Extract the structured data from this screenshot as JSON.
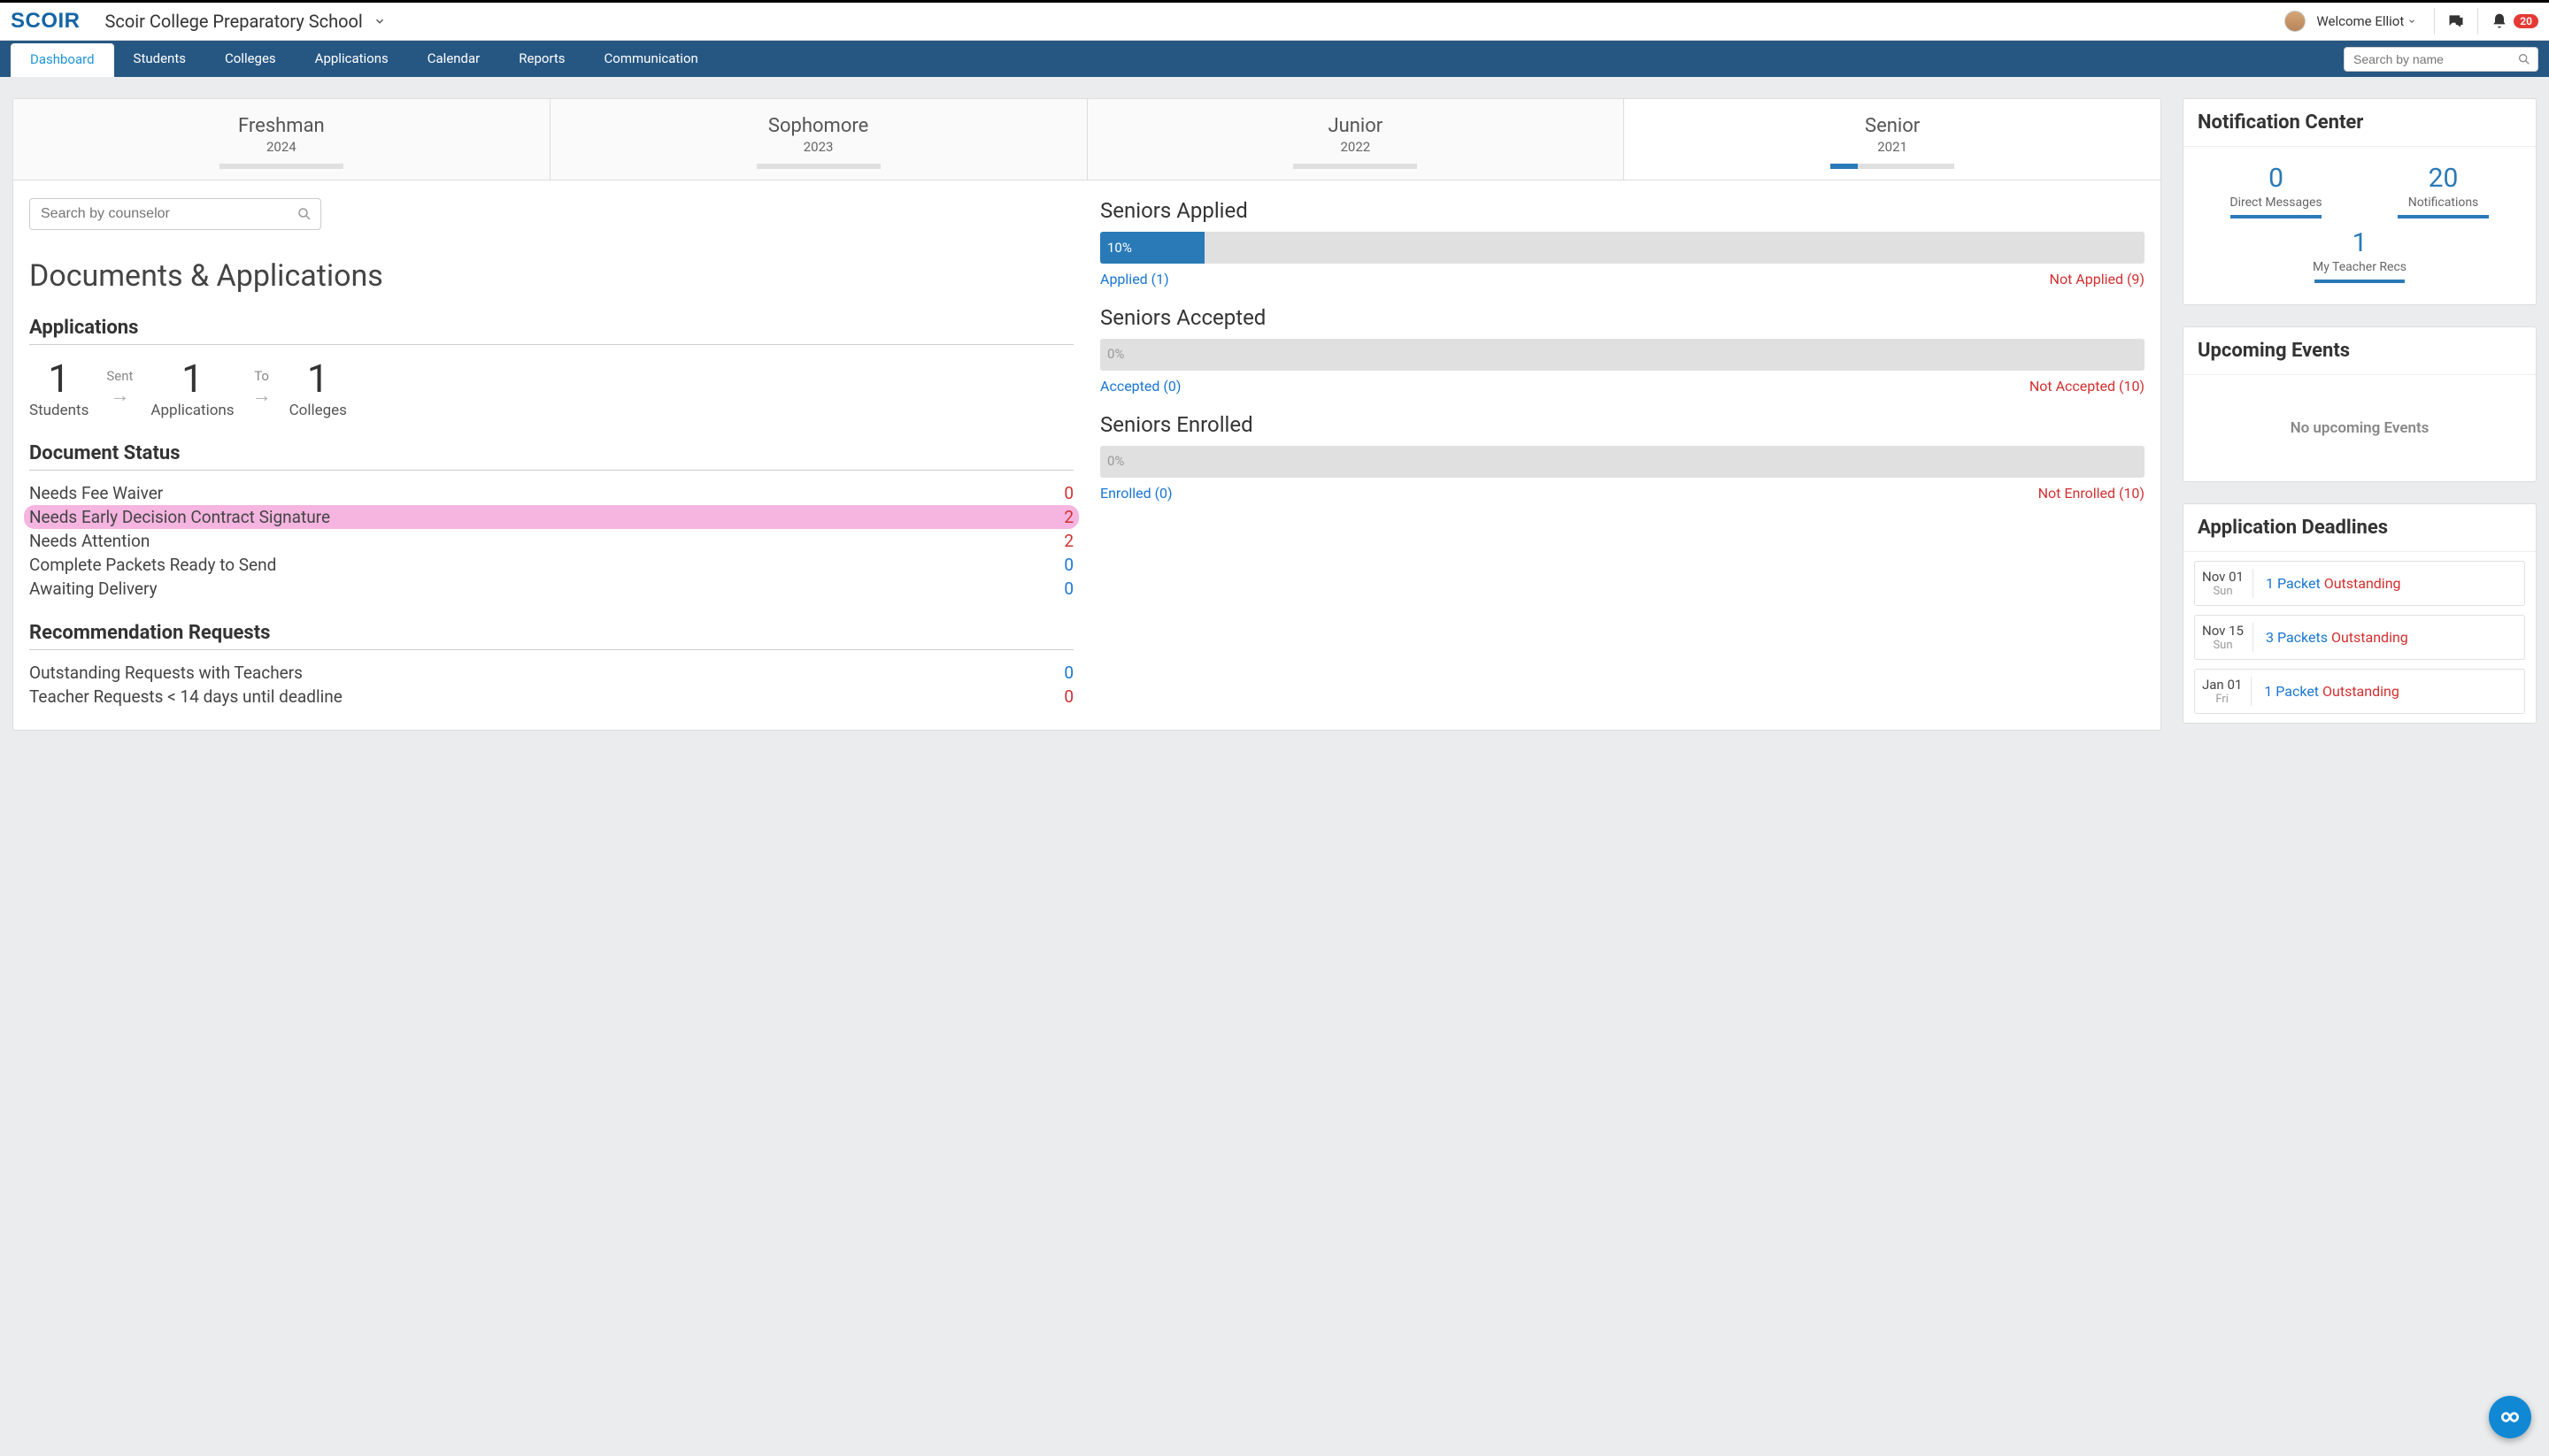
{
  "header": {
    "logo": "SCOIR",
    "school": "Scoir College Preparatory School",
    "welcome": "Welcome Elliot",
    "notification_badge": "20"
  },
  "nav": {
    "tabs": [
      "Dashboard",
      "Students",
      "Colleges",
      "Applications",
      "Calendar",
      "Reports",
      "Communication"
    ],
    "active_index": 0,
    "search_placeholder": "Search by name"
  },
  "class_tabs": [
    {
      "name": "Freshman",
      "year": "2024",
      "progress_pct": 0
    },
    {
      "name": "Sophomore",
      "year": "2023",
      "progress_pct": 0
    },
    {
      "name": "Junior",
      "year": "2022",
      "progress_pct": 0
    },
    {
      "name": "Senior",
      "year": "2021",
      "progress_pct": 22
    }
  ],
  "selected_class_index": 3,
  "counselor_search_placeholder": "Search by counselor",
  "page_title": "Documents & Applications",
  "applications": {
    "heading": "Applications",
    "students": {
      "count": "1",
      "label": "Students"
    },
    "sent_label": "Sent",
    "apps": {
      "count": "1",
      "label": "Applications"
    },
    "to_label": "To",
    "colleges": {
      "count": "1",
      "label": "Colleges"
    }
  },
  "doc_status": {
    "heading": "Document Status",
    "rows": [
      {
        "label": "Needs Fee Waiver",
        "value": "0",
        "color": "red",
        "hl": false
      },
      {
        "label": "Needs Early Decision Contract Signature",
        "value": "2",
        "color": "red",
        "hl": true
      },
      {
        "label": "Needs Attention",
        "value": "2",
        "color": "red",
        "hl": false
      },
      {
        "label": "Complete Packets Ready to Send",
        "value": "0",
        "color": "blue",
        "hl": false
      },
      {
        "label": "Awaiting Delivery",
        "value": "0",
        "color": "blue",
        "hl": false
      }
    ]
  },
  "rec_requests": {
    "heading": "Recommendation Requests",
    "rows": [
      {
        "label": "Outstanding Requests with Teachers",
        "value": "0",
        "color": "blue"
      },
      {
        "label": "Teacher Requests < 14 days until deadline",
        "value": "0",
        "color": "red"
      }
    ]
  },
  "progress": [
    {
      "title": "Seniors Applied",
      "pct": 10,
      "pct_text": "10%",
      "left": "Applied (1)",
      "right": "Not Applied (9)"
    },
    {
      "title": "Seniors Accepted",
      "pct": 0,
      "pct_text": "0%",
      "left": "Accepted (0)",
      "right": "Not Accepted (10)"
    },
    {
      "title": "Seniors Enrolled",
      "pct": 0,
      "pct_text": "0%",
      "left": "Enrolled (0)",
      "right": "Not Enrolled (10)"
    }
  ],
  "notification_center": {
    "heading": "Notification Center",
    "items": [
      {
        "count": "0",
        "label": "Direct Messages"
      },
      {
        "count": "20",
        "label": "Notifications"
      },
      {
        "count": "1",
        "label": "My Teacher Recs"
      }
    ]
  },
  "upcoming_events": {
    "heading": "Upcoming Events",
    "empty": "No upcoming Events"
  },
  "deadlines": {
    "heading": "Application Deadlines",
    "items": [
      {
        "date": "Nov 01",
        "day": "Sun",
        "link": "1 Packet",
        "status": "Outstanding"
      },
      {
        "date": "Nov 15",
        "day": "Sun",
        "link": "3 Packets",
        "status": "Outstanding"
      },
      {
        "date": "Jan 01",
        "day": "Fri",
        "link": "1 Packet",
        "status": "Outstanding"
      }
    ]
  }
}
